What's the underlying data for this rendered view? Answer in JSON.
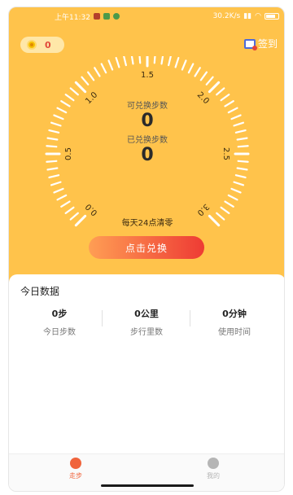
{
  "status_bar": {
    "time": "上午11:32",
    "speed": "30.2K/s"
  },
  "header": {
    "coins": "0",
    "signin_label": "签到"
  },
  "gauge": {
    "ticks": [
      "0.0",
      "0.5",
      "1.0",
      "1.5",
      "2.0",
      "2.5",
      "3.0"
    ],
    "redeemable_label": "可兑换步数",
    "redeemable_value": "0",
    "redeemed_label": "已兑换步数",
    "redeemed_value": "0",
    "reset_note": "每天24点清零"
  },
  "action": {
    "redeem_label": "点击兑换"
  },
  "today": {
    "title": "今日数据",
    "stats": [
      {
        "value": "0步",
        "label": "今日步数"
      },
      {
        "value": "0公里",
        "label": "步行里数"
      },
      {
        "value": "0分钟",
        "label": "使用时间"
      }
    ]
  },
  "tabs": [
    {
      "label": "走步",
      "color": "#f0643c"
    },
    {
      "label": "我的",
      "color": "#b5b5b5"
    }
  ],
  "colors": {
    "accent": "#ffc34b",
    "button_start": "#ff9e54",
    "button_end": "#ee3b34"
  }
}
